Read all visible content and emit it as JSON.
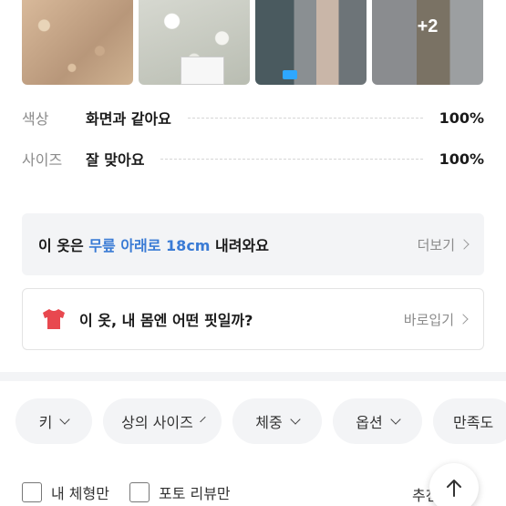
{
  "photos": {
    "more_count": "+2"
  },
  "ratings": [
    {
      "key": "색상",
      "value": "화면과 같아요",
      "percent": "100%"
    },
    {
      "key": "사이즈",
      "value": "잘 맞아요",
      "percent": "100%"
    }
  ],
  "length_card": {
    "prefix": "이 옷은 ",
    "highlight": "무릎 아래로 18cm",
    "suffix": " 내려와요",
    "link": "더보기"
  },
  "fit_card": {
    "text": "이 옷, 내 몸엔 어떤 핏일까?",
    "link": "바로입기",
    "icon": "shirt-icon"
  },
  "filters": [
    "키",
    "상의 사이즈",
    "체중",
    "옵션",
    "만족도"
  ],
  "options": {
    "my_body": "내 체형만",
    "photo_review": "포토 리뷰만",
    "sort": "추천순"
  },
  "colors": {
    "accent": "#3a7bd5",
    "shirt": "#e8484f"
  }
}
